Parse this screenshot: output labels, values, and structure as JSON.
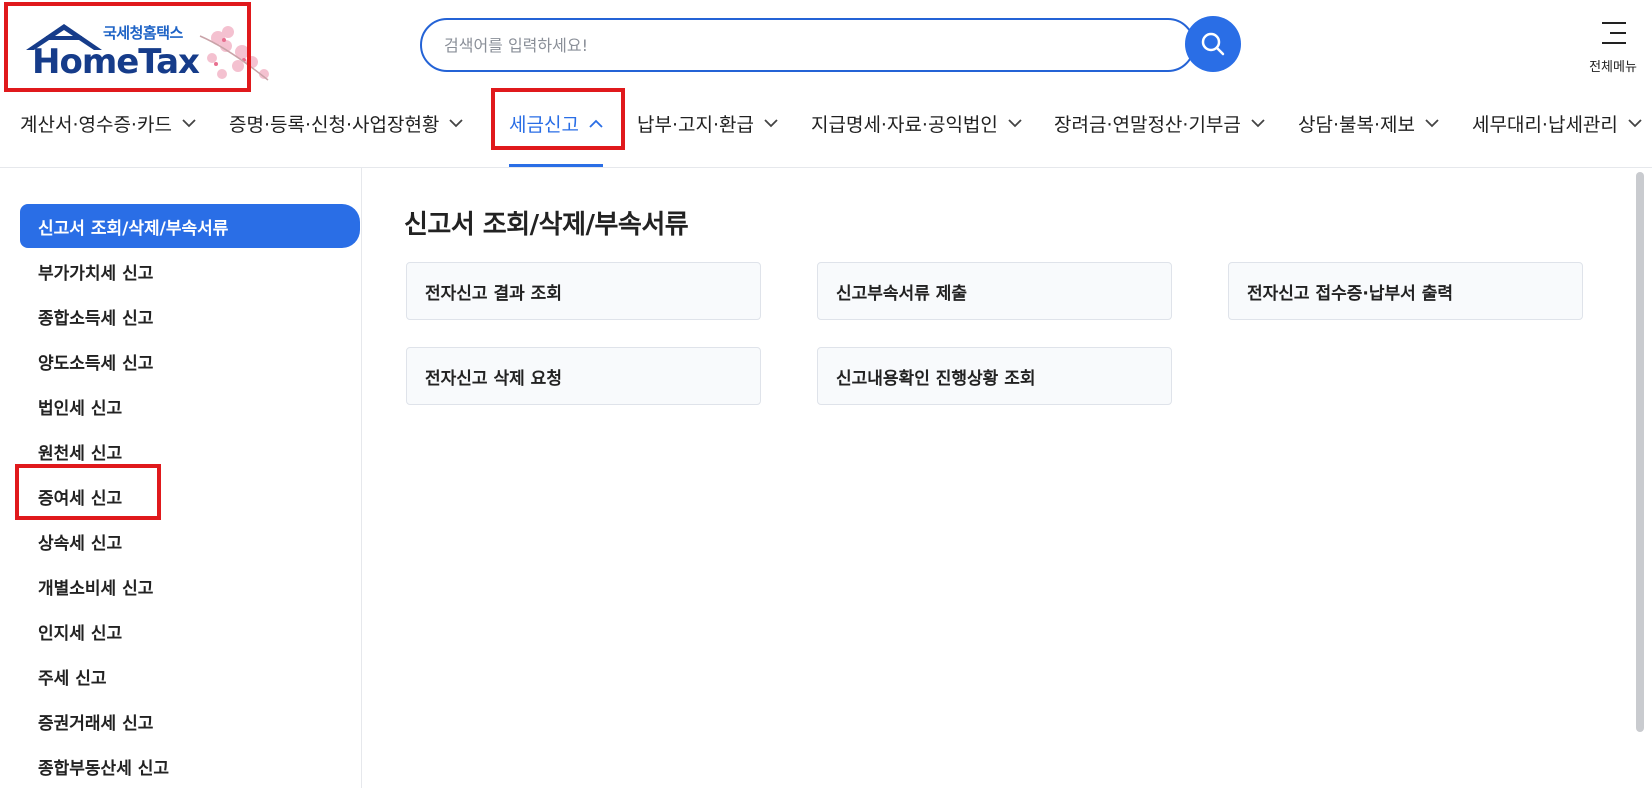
{
  "logo": {
    "kr": "국세청홈택스",
    "en": "HomeTax"
  },
  "search": {
    "placeholder": "검색어를 입력하세요!"
  },
  "all_menu_label": "전체메뉴",
  "gnb": [
    {
      "label": "계산서·영수증·카드",
      "expanded": false
    },
    {
      "label": "증명·등록·신청·사업장현황",
      "expanded": false
    },
    {
      "label": "세금신고",
      "expanded": true
    },
    {
      "label": "납부·고지·환급",
      "expanded": false
    },
    {
      "label": "지급명세·자료·공익법인",
      "expanded": false
    },
    {
      "label": "장려금·연말정산·기부금",
      "expanded": false
    },
    {
      "label": "상담·불복·제보",
      "expanded": false
    },
    {
      "label": "세무대리·납세관리",
      "expanded": false
    }
  ],
  "sidebar": {
    "items": [
      {
        "label": "신고서 조회/삭제/부속서류",
        "active": true
      },
      {
        "label": "부가가치세 신고"
      },
      {
        "label": "종합소득세 신고"
      },
      {
        "label": "양도소득세 신고"
      },
      {
        "label": "법인세 신고"
      },
      {
        "label": "원천세 신고"
      },
      {
        "label": "증여세 신고"
      },
      {
        "label": "상속세 신고"
      },
      {
        "label": "개별소비세 신고"
      },
      {
        "label": "인지세 신고"
      },
      {
        "label": "주세 신고"
      },
      {
        "label": "증권거래세 신고"
      },
      {
        "label": "종합부동산세 신고"
      }
    ]
  },
  "main": {
    "title": "신고서 조회/삭제/부속서류",
    "cards": [
      {
        "label": "전자신고 결과 조회"
      },
      {
        "label": "신고부속서류 제출"
      },
      {
        "label": "전자신고 접수증·납부서 출력"
      },
      {
        "label": "전자신고 삭제 요청"
      },
      {
        "label": "신고내용확인 진행상황 조회"
      }
    ]
  },
  "colors": {
    "accent": "#2a6ee6",
    "highlight": "#e0191c",
    "logo_navy": "#163c8a"
  },
  "icons": {
    "search": "search-icon",
    "menu": "hamburger-icon",
    "chevron": "chevron-down-icon"
  }
}
